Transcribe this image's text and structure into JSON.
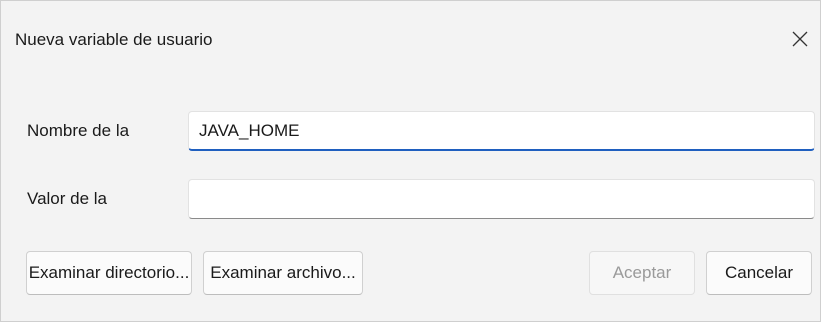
{
  "dialog": {
    "title": "Nueva variable de usuario"
  },
  "form": {
    "name_label": "Nombre de la",
    "name_value": "JAVA_HOME",
    "value_label": "Valor de la",
    "value_value": ""
  },
  "buttons": {
    "browse_directory": "Examinar directorio...",
    "browse_file": "Examinar archivo...",
    "accept": "Aceptar",
    "cancel": "Cancelar"
  },
  "icons": {
    "close": "close-icon"
  },
  "colors": {
    "focus_accent": "#1f5fbf",
    "dialog_background": "#f3f3f3",
    "disabled_text": "#9a9a9a"
  }
}
